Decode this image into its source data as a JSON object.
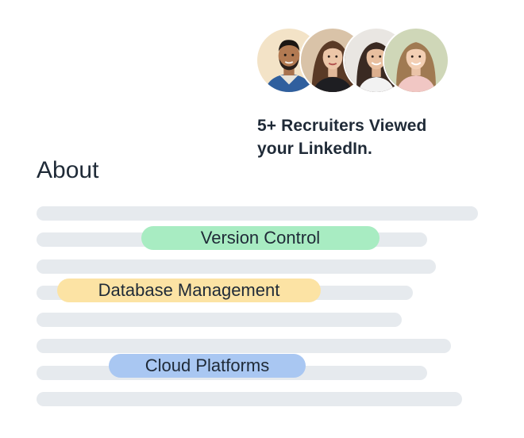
{
  "recruiters": {
    "text_line1": "5+ Recruiters Viewed",
    "text_line2": "your LinkedIn."
  },
  "avatars": [
    {
      "icon": "profile-photo-man-beard",
      "bg": "#f3e3c7"
    },
    {
      "icon": "profile-photo-woman-brown-hair",
      "bg": "#d9c3a8"
    },
    {
      "icon": "profile-photo-woman-dark-hair",
      "bg": "#e9e6e2"
    },
    {
      "icon": "profile-photo-woman-light-hair",
      "bg": "#cfd7b8"
    }
  ],
  "about": {
    "title": "About"
  },
  "skills": [
    {
      "label": "Version Control",
      "color": "#a8ecc2"
    },
    {
      "label": "Database Management",
      "color": "#fce3a4"
    },
    {
      "label": "Cloud Platforms",
      "color": "#a9c7f2"
    }
  ],
  "colors": {
    "placeholder_line": "#e6eaee",
    "text": "#1f2a37"
  }
}
